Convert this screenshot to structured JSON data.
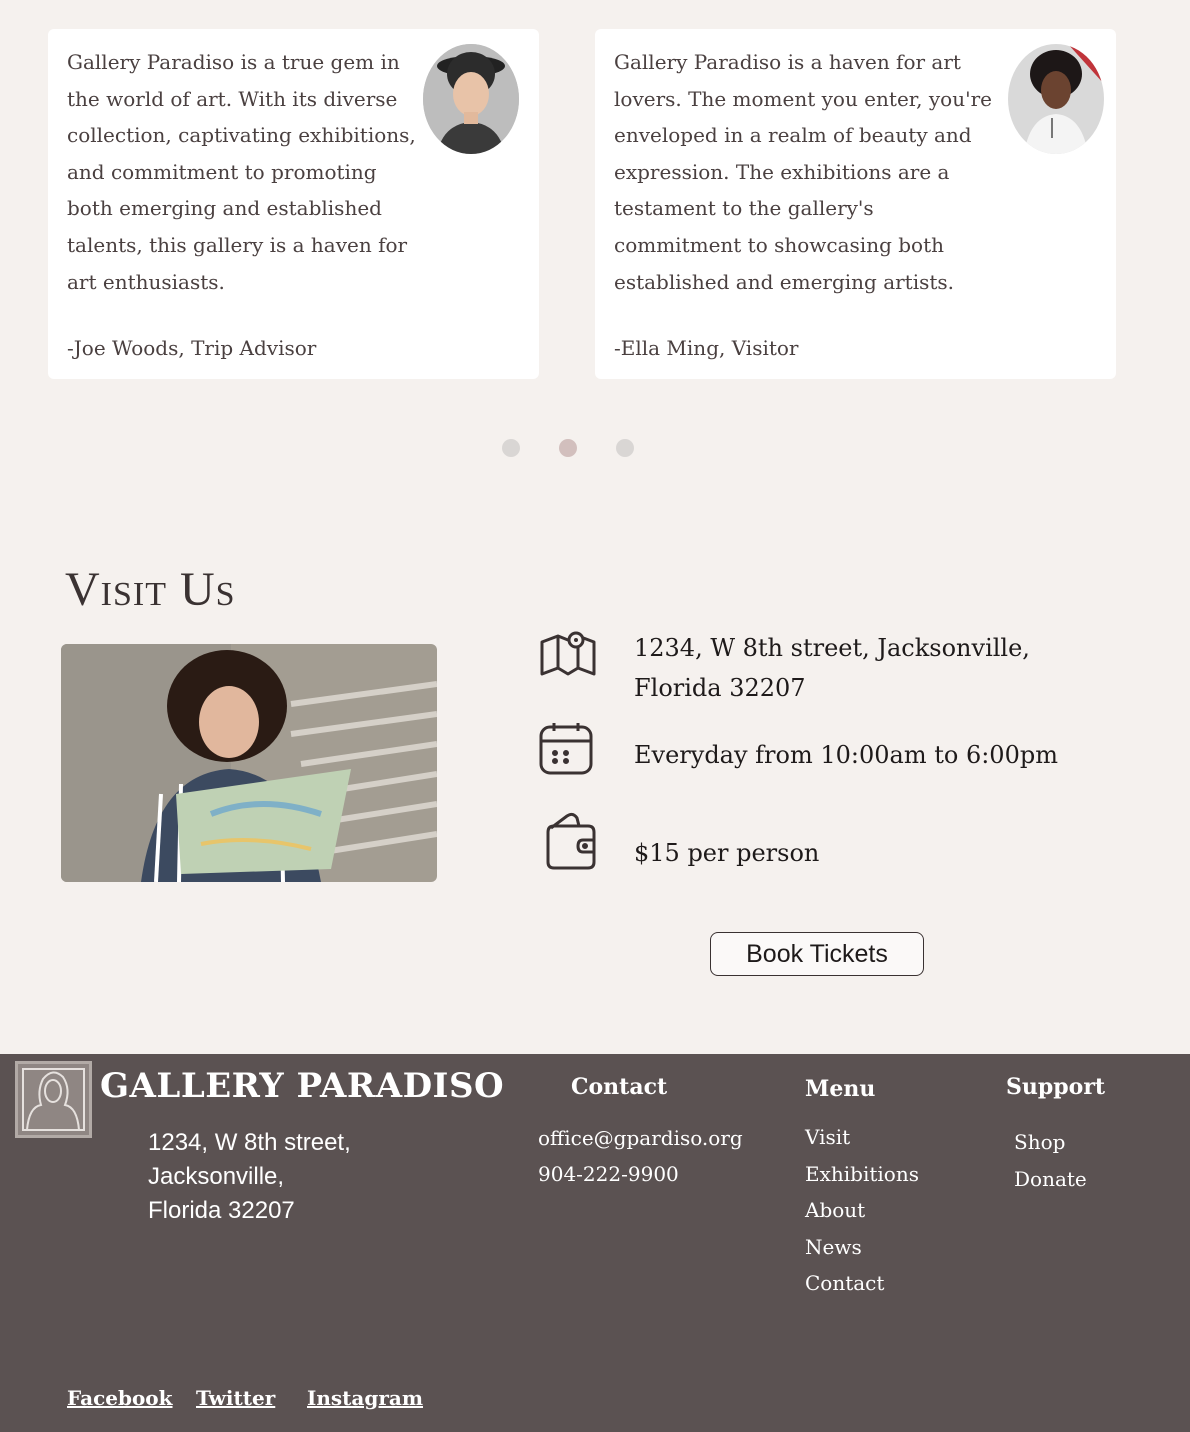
{
  "testimonials": [
    {
      "text": "Gallery Paradiso is a true gem in\nthe world of art. With its diverse\ncollection, captivating exhibitions,\nand commitment to promoting\nboth emerging and established\ntalents, this gallery is a haven for\nart enthusiasts.",
      "author": "-Joe Woods, Trip Advisor"
    },
    {
      "text": "Gallery Paradiso is a haven for art\nlovers. The moment you enter, you're\nenveloped in a realm of beauty and\nexpression. The exhibitions are a\ntestament to the gallery's\ncommitment to showcasing both\nestablished and emerging artists.",
      "author": "-Ella Ming, Visitor"
    }
  ],
  "carousel": {
    "count": 3,
    "active_index": 1
  },
  "visit": {
    "title": "Visit Us",
    "address": "1234, W  8th street,  Jacksonville,\nFlorida 32207",
    "hours": "Everyday from 10:00am to 6:00pm",
    "price": "$15 per person",
    "book_label": "Book Tickets"
  },
  "footer": {
    "brand": "GALLERY PARADISO",
    "address": "1234, W  8th street,\nJacksonville,\nFlorida 32207",
    "contact_heading": "Contact",
    "email": "office@gpardiso.org",
    "phone": "904-222-9900",
    "menu_heading": "Menu",
    "menu_items": [
      "Visit",
      "Exhibitions",
      "About",
      "News",
      "Contact"
    ],
    "support_heading": "Support",
    "support_items": [
      "Shop",
      "Donate"
    ],
    "social": [
      "Facebook",
      "Twitter",
      "Instagram"
    ]
  },
  "colors": {
    "page_bg": "#f5f1ee",
    "footer_bg": "#5b5252",
    "dot_active": "#d2bfbd",
    "dot_inactive": "#d9d6d4"
  },
  "icons": [
    "map-pin-icon",
    "calendar-icon",
    "wallet-icon",
    "gallery-logo-icon"
  ]
}
